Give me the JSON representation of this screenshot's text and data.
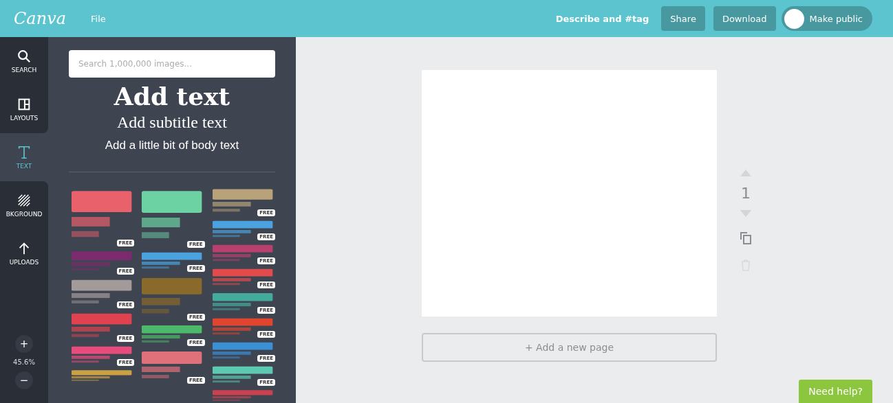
{
  "top_bar": {
    "logo": "Canva",
    "menu": [
      "File"
    ],
    "describe": "Describe and #tag",
    "buttons": [
      "Share",
      "Download"
    ],
    "toggle": {
      "label": "Make public",
      "on": false
    }
  },
  "nav": [
    {
      "kind": "search",
      "label": "SEARCH",
      "selected": false
    },
    {
      "kind": "layouts",
      "label": "LAYOUTS",
      "selected": false
    },
    {
      "kind": "text",
      "label": "TEXT",
      "selected": true
    },
    {
      "kind": "background",
      "label": "BKGROUND",
      "selected": false
    },
    {
      "kind": "uploads",
      "label": "UPLOADS",
      "selected": false
    }
  ],
  "zoom": {
    "plus": "+",
    "value": "45.6%",
    "minus": "−"
  },
  "panel": {
    "search": {
      "placeholder": "Search 1,000,000 images..."
    },
    "heading": "Add text",
    "subtitle": "Add subtitle text",
    "body": "Add a little bit of body text",
    "template_columns": [
      [
        {
          "badge": "FREE"
        },
        {
          "badge": "FREE"
        },
        {
          "badge": "FREE"
        },
        {
          "badge": "FREE"
        },
        {
          "badge": "FREE"
        },
        {
          "kind": "picture"
        }
      ],
      [
        {
          "badge": "FREE"
        },
        {
          "badge": "FREE"
        },
        {
          "badge": "FREE"
        },
        {
          "badge": "FREE"
        },
        {
          "badge": "FREE"
        }
      ],
      [
        {
          "badge": "FREE"
        },
        {
          "badge": "FREE"
        },
        {
          "badge": "FREE"
        },
        {
          "badge": "FREE"
        },
        {
          "badge": "FREE"
        },
        {
          "badge": "FREE"
        },
        {
          "badge": "FREE"
        },
        {
          "badge": "FREE"
        },
        {
          "kind": "picture"
        }
      ]
    ]
  },
  "canvas": {
    "add_page": "+ Add a new page",
    "page_number": "1",
    "help": "Need help?"
  }
}
